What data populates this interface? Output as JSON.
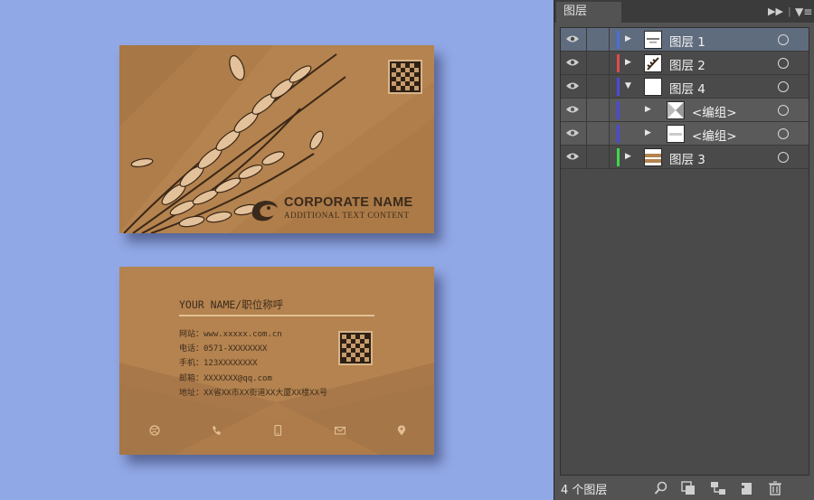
{
  "front_card": {
    "corporate_name": "CORPORATE NAME",
    "subtitle": "ADDITIONAL TEXT CONTENT"
  },
  "back_card": {
    "your_name": "YOUR NAME/职位称呼",
    "website": "网站：www.xxxxx.com.cn",
    "phone": "电话：0571-XXXXXXXX",
    "mobile": "手机：123XXXXXXXX",
    "email": "邮箱：XXXXXXX@qq.com",
    "address": "地址：XX省XX市XX街道XX大厦XX楼XX号",
    "icons": [
      "dribbble-icon",
      "phone-icon",
      "mobile-icon",
      "mail-icon",
      "location-pin-icon"
    ]
  },
  "panel": {
    "tab_title": "图层",
    "layers": [
      {
        "label": "图层 1",
        "color": "#4a6ee0",
        "expanded": false,
        "selected": true
      },
      {
        "label": "图层 2",
        "color": "#e04a4a",
        "expanded": false
      },
      {
        "label": "图层 4",
        "color": "#4a4ae0",
        "expanded": true
      },
      {
        "label": "<编组>",
        "color": "#4a4ae0",
        "sublayer": true
      },
      {
        "label": "<编组>",
        "color": "#4a4ae0",
        "sublayer": true
      },
      {
        "label": "图层 3",
        "color": "#3fd84a",
        "expanded": false
      }
    ],
    "footer_count": "4 个图层"
  },
  "colors": {
    "card": "#b4834f",
    "background": "#91a8e6",
    "panel": "#535353"
  }
}
